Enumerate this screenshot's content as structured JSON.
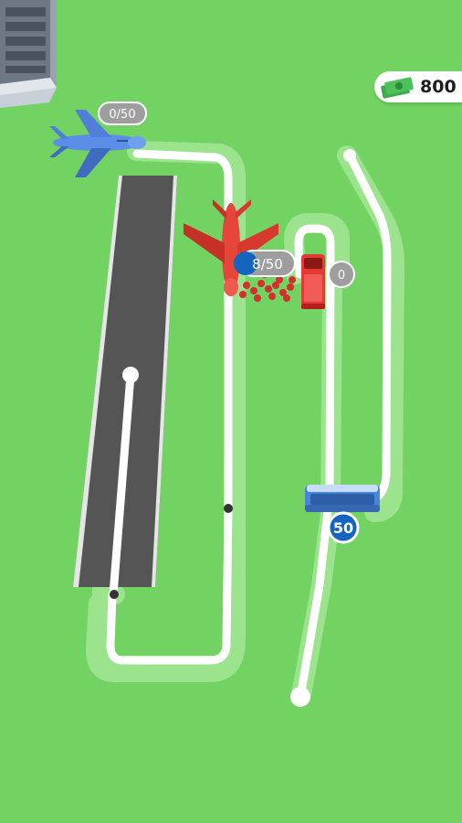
{
  "hud": {
    "money_value": "800",
    "money_icon": "cash-stack-icon"
  },
  "planes": [
    {
      "name": "blue-plane",
      "color": "#5b8ee6",
      "counter": "0/50"
    },
    {
      "name": "red-plane",
      "color": "#e5453a",
      "counter": "8/50"
    }
  ],
  "red_bus": {
    "color": "#e53935",
    "counter": "0"
  },
  "blue_bus": {
    "color": "#4a86d8",
    "counter": "50"
  },
  "colors": {
    "grass": "#72d363",
    "runway": "#555555",
    "path_shadow": "#9be38d",
    "path": "#ffffff",
    "counter_badge": "#9e9e9e",
    "active_badge": "#1565c0"
  }
}
